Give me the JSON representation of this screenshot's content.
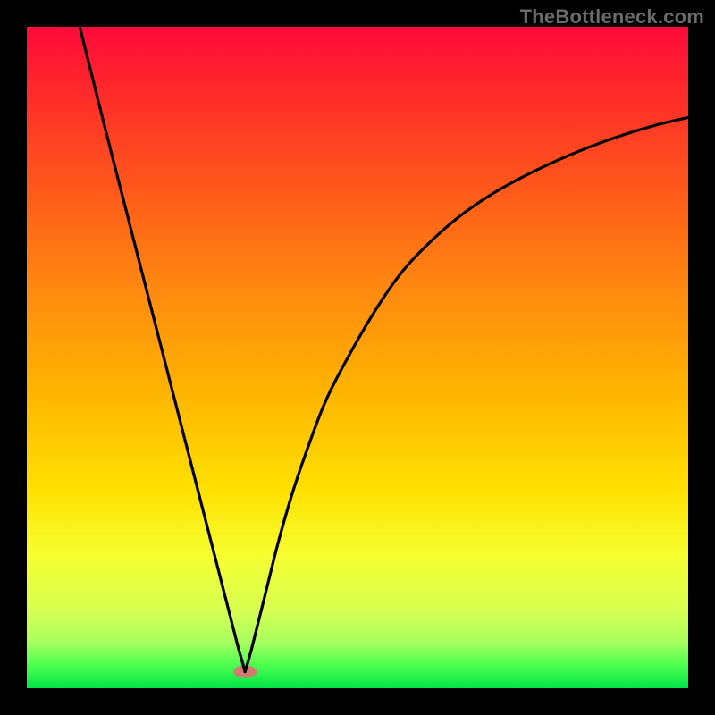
{
  "watermark": "TheBottleneck.com",
  "chart_data": {
    "type": "line",
    "title": "",
    "xlabel": "",
    "ylabel": "",
    "xlim": [
      0,
      100
    ],
    "ylim": [
      0,
      100
    ],
    "grid": false,
    "legend": false,
    "description": "Bottleneck-style plot: black V-curve on vertical rainbow gradient (red→orange→yellow→green). Left branch steep linear from top-left to a minimum near x≈33; right branch rises concavely toward upper-right. Small pink patch at the minimum; thin bright-green band along the bottom edge.",
    "gradient_stops": [
      {
        "offset": 0.0,
        "color": "#ff0a3a"
      },
      {
        "offset": 0.1,
        "color": "#ff2a2a"
      },
      {
        "offset": 0.25,
        "color": "#ff5a1a"
      },
      {
        "offset": 0.4,
        "color": "#ff8a10"
      },
      {
        "offset": 0.55,
        "color": "#ffb400"
      },
      {
        "offset": 0.7,
        "color": "#ffe000"
      },
      {
        "offset": 0.8,
        "color": "#f6ff30"
      },
      {
        "offset": 0.88,
        "color": "#d8ff50"
      },
      {
        "offset": 0.93,
        "color": "#a8ff60"
      },
      {
        "offset": 0.965,
        "color": "#4dff4d"
      },
      {
        "offset": 1.0,
        "color": "#00e548"
      }
    ],
    "series": [
      {
        "name": "left-branch",
        "x": [
          8,
          10,
          12,
          14,
          16,
          18,
          20,
          22,
          24,
          26,
          28,
          30,
          32,
          33
        ],
        "y": [
          100,
          92,
          84,
          76.2,
          68.4,
          60.6,
          52.8,
          45,
          37.2,
          29.4,
          21.6,
          13.8,
          6,
          2.5
        ]
      },
      {
        "name": "right-branch",
        "x": [
          33,
          34,
          36,
          38,
          40,
          42,
          45,
          48,
          52,
          56,
          60,
          65,
          70,
          75,
          80,
          85,
          90,
          95,
          100
        ],
        "y": [
          2.5,
          6,
          14,
          22,
          29,
          35,
          43,
          49,
          56,
          62,
          66.5,
          71,
          74.5,
          77.3,
          79.7,
          81.8,
          83.6,
          85.1,
          86.3
        ]
      }
    ],
    "minimum_marker": {
      "x": 33,
      "y": 2.5,
      "color": "#d47a72"
    }
  }
}
